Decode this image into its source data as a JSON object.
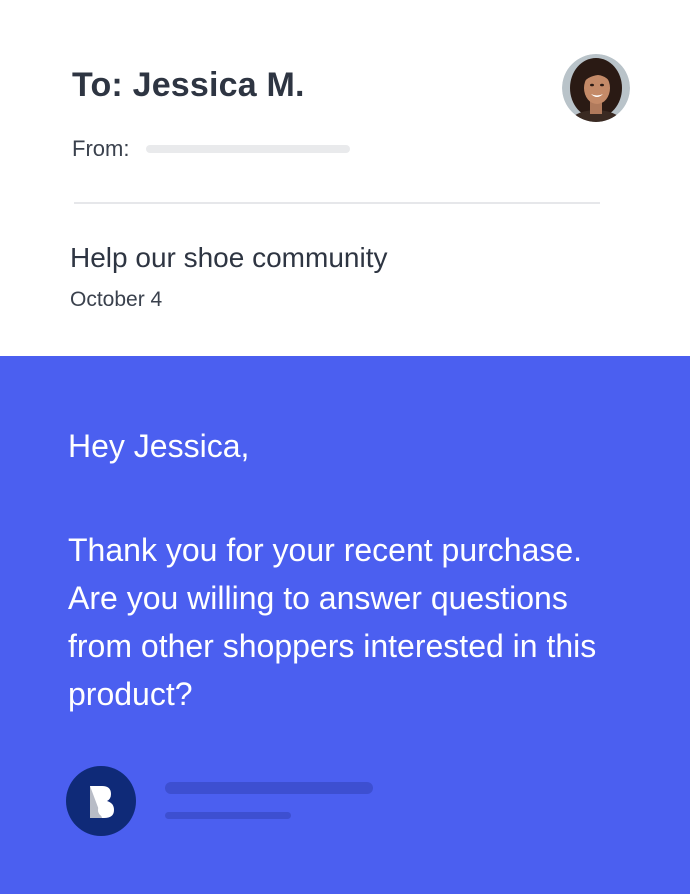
{
  "header": {
    "to_line": "To: Jessica M.",
    "from_label": "From:",
    "avatar_icon": "user-avatar-photo"
  },
  "email": {
    "subject": "Help our shoe community",
    "date": "October 4"
  },
  "body": {
    "greeting": "Hey Jessica,",
    "message": "Thank you for your recent purchase. Are you willing to answer questions from other shoppers interested in this product?",
    "sender_logo_icon": "brand-b-logo"
  },
  "colors": {
    "panel_background": "#4b5ff0",
    "logo_background": "#0f2a78",
    "heading_text": "#2e3542"
  }
}
